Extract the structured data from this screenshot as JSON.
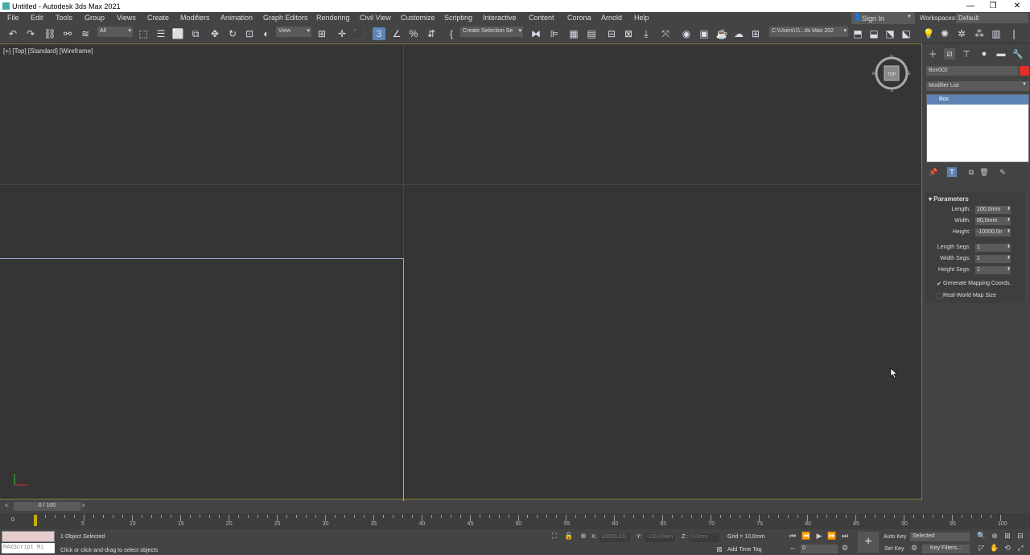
{
  "window": {
    "title": "Untitled - Autodesk 3ds Max 2021",
    "minimize": "—",
    "restore": "❐",
    "close": "✕"
  },
  "menu": [
    "File",
    "Edit",
    "Tools",
    "Group",
    "Views",
    "Create",
    "Modifiers",
    "Animation",
    "Graph Editors",
    "Rendering",
    "Civil View",
    "Customize",
    "Scripting",
    "Interactive",
    "Content",
    "Corona",
    "Arnold",
    "Help"
  ],
  "account": {
    "sign_in": "Sign In",
    "workspaces_label": "Workspaces:",
    "workspace": "Default"
  },
  "toolbar": {
    "selection_filter": "All",
    "ref_coord": "View",
    "named_selection": "Create Selection Se",
    "project_path": "C:\\Users\\1\\...ds Max 202"
  },
  "viewport": {
    "label": "[+] [Top] [Standard] [Wireframe]",
    "navcube": {
      "face": "TOP",
      "n": "N",
      "s": "S",
      "e": "E",
      "w": "W"
    }
  },
  "command_panel": {
    "object_name": "Box002",
    "object_color": "#e0302a",
    "modifier_list": "Modifier List",
    "stack": [
      "Box"
    ],
    "rollout": "Parameters",
    "params": [
      {
        "label": "Length:",
        "value": "100,0mm"
      },
      {
        "label": "Width:",
        "value": "80,0mm"
      },
      {
        "label": "Height:",
        "value": "-10000,0n"
      },
      {
        "label": "Length Segs:",
        "value": "1"
      },
      {
        "label": "Width Segs:",
        "value": "1"
      },
      {
        "label": "Height Segs:",
        "value": "1"
      }
    ],
    "checkboxes": [
      {
        "label": "Generate Mapping Coords.",
        "checked": true,
        "mark": "✔"
      },
      {
        "label": "Real-World Map Size",
        "checked": false,
        "mark": ""
      }
    ]
  },
  "timeline": {
    "frame": "0 / 100",
    "ticks": [
      "5",
      "10",
      "15",
      "20",
      "25",
      "30",
      "35",
      "40",
      "45",
      "50",
      "55",
      "60",
      "65",
      "70",
      "75",
      "80",
      "85",
      "90",
      "95",
      "100"
    ],
    "zero": "0"
  },
  "status": {
    "selected": "1 Object Selected",
    "prompt": "Click or click-and-drag to select objects",
    "maxscript": "MAXScript Mi",
    "x_label": "X:",
    "x": "10000,011",
    "y_label": "Y:",
    "y": "-130,004m",
    "z_label": "Z:",
    "z": "0,0mm",
    "grid": "Grid = 10,0mm",
    "add_time_tag": "Add Time Tag",
    "auto_key": "Auto Key",
    "set_key": "Set Key",
    "key_mode": "Selected",
    "key_filters": "Key Filters...",
    "frame_field": "0"
  }
}
